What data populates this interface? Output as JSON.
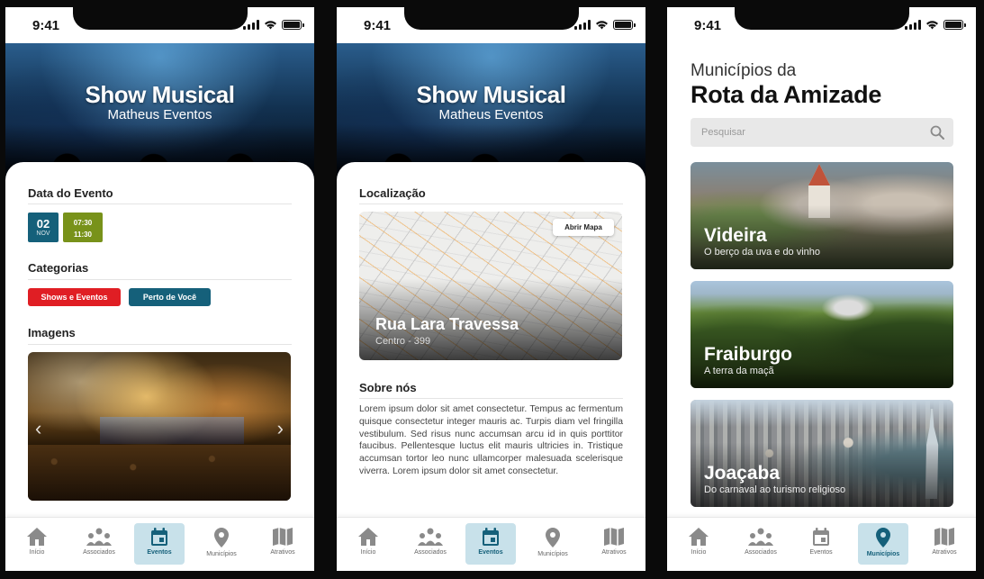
{
  "status": {
    "time": "9:41"
  },
  "event": {
    "title": "Show Musical",
    "organizer": "Matheus Eventos",
    "date_section": "Data do Evento",
    "day": "02",
    "month": "NOV",
    "start": "07:30",
    "end": "11:30",
    "categories_section": "Categorias",
    "categories": [
      "Shows e Eventos",
      "Perto de Você"
    ],
    "images_section": "Imagens",
    "location_section": "Localização",
    "map_button": "Abrir Mapa",
    "street": "Rua Lara Travessa",
    "district": "Centro - 399",
    "about_section": "Sobre nós",
    "about_text": "Lorem ipsum dolor sit amet consectetur. Tempus ac fermentum quisque consectetur integer mauris ac. Turpis diam vel fringilla vestibulum. Sed risus nunc accumsan arcu id in quis porttitor faucibus. Pellentesque luctus elit mauris ultricies in. Tristique accumsan tortor leo nunc ullamcorper malesuada scelerisque viverra. Lorem ipsum dolor sit amet consectetur."
  },
  "municipios": {
    "title_line1": "Municípios da",
    "title_line2": "Rota da Amizade",
    "search_placeholder": "Pesquisar",
    "cards": [
      {
        "name": "Videira",
        "subtitle": "O berço da uva e do vinho"
      },
      {
        "name": "Fraiburgo",
        "subtitle": "A terra da maçã"
      },
      {
        "name": "Joaçaba",
        "subtitle": "Do carnaval ao turismo religioso"
      }
    ]
  },
  "nav": {
    "items": [
      "Início",
      "Associados",
      "Eventos",
      "Municípios",
      "Atrativos"
    ]
  },
  "colors": {
    "primary": "#15607a",
    "red": "#e01e24",
    "green": "#78921a",
    "nav_active_bg": "#c8e1ea"
  }
}
